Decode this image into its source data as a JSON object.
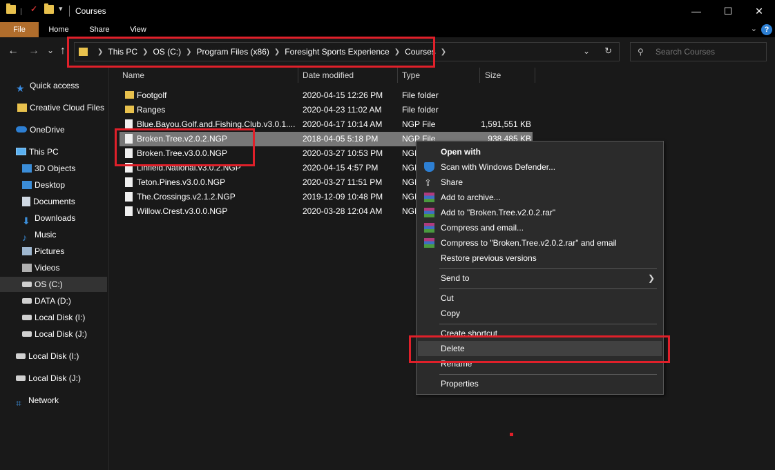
{
  "window": {
    "title": "Courses",
    "controls": {
      "minimize": "—",
      "maximize": "☐",
      "close": "✕"
    }
  },
  "ribbon": {
    "tabs": [
      "File",
      "Home",
      "Share",
      "View"
    ],
    "help": "?"
  },
  "nav": {
    "back": "←",
    "forward": "→",
    "recent": "⌄",
    "up": "↑",
    "breadcrumbs": [
      "This PC",
      "OS (C:)",
      "Program Files (x86)",
      "Foresight Sports Experience",
      "Courses"
    ],
    "search_placeholder": "Search Courses"
  },
  "sidebar": {
    "items": [
      "Quick access",
      "Creative Cloud Files",
      "OneDrive",
      "This PC",
      "3D Objects",
      "Desktop",
      "Documents",
      "Downloads",
      "Music",
      "Pictures",
      "Videos",
      "OS (C:)",
      "DATA (D:)",
      "Local Disk (I:)",
      "Local Disk (J:)",
      "Local Disk (I:)",
      "Local Disk (J:)",
      "Network"
    ]
  },
  "columns": {
    "name": "Name",
    "date": "Date modified",
    "type": "Type",
    "size": "Size"
  },
  "files": [
    {
      "name": "Footgolf",
      "date": "2020-04-15 12:26 PM",
      "type": "File folder",
      "size": ""
    },
    {
      "name": "Ranges",
      "date": "2020-04-23 11:02 AM",
      "type": "File folder",
      "size": ""
    },
    {
      "name": "Blue.Bayou.Golf.and.Fishing.Club.v3.0.1....",
      "date": "2020-04-17 10:14 AM",
      "type": "NGP File",
      "size": "1,591,551 KB"
    },
    {
      "name": "Broken.Tree.v2.0.2.NGP",
      "date": "2018-04-05 5:18 PM",
      "type": "NGP File",
      "size": "938,485 KB"
    },
    {
      "name": "Broken.Tree.v3.0.0.NGP",
      "date": "2020-03-27 10:53 PM",
      "type": "NGP",
      "size": ""
    },
    {
      "name": "Linfield.National.v3.0.2.NGP",
      "date": "2020-04-15 4:57 PM",
      "type": "NGP",
      "size": ""
    },
    {
      "name": "Teton.Pines.v3.0.0.NGP",
      "date": "2020-03-27 11:51 PM",
      "type": "NGP",
      "size": ""
    },
    {
      "name": "The.Crossings.v2.1.2.NGP",
      "date": "2019-12-09 10:48 PM",
      "type": "NGP",
      "size": ""
    },
    {
      "name": "Willow.Crest.v3.0.0.NGP",
      "date": "2020-03-28 12:04 AM",
      "type": "NGP",
      "size": ""
    }
  ],
  "context_menu": {
    "open_with": "Open with",
    "scan": "Scan with Windows Defender...",
    "share": "Share",
    "add_archive": "Add to archive...",
    "add_rar": "Add to \"Broken.Tree.v2.0.2.rar\"",
    "compress_email": "Compress and email...",
    "compress_rar_email": "Compress to \"Broken.Tree.v2.0.2.rar\" and email",
    "restore": "Restore previous versions",
    "send_to": "Send to",
    "cut": "Cut",
    "copy": "Copy",
    "create_shortcut": "Create shortcut",
    "delete": "Delete",
    "rename": "Rename",
    "properties": "Properties"
  },
  "colors": {
    "accent_file_tab": "#b06d2c",
    "annotation_red": "#e0202a",
    "folder_yellow": "#e8c14d"
  }
}
